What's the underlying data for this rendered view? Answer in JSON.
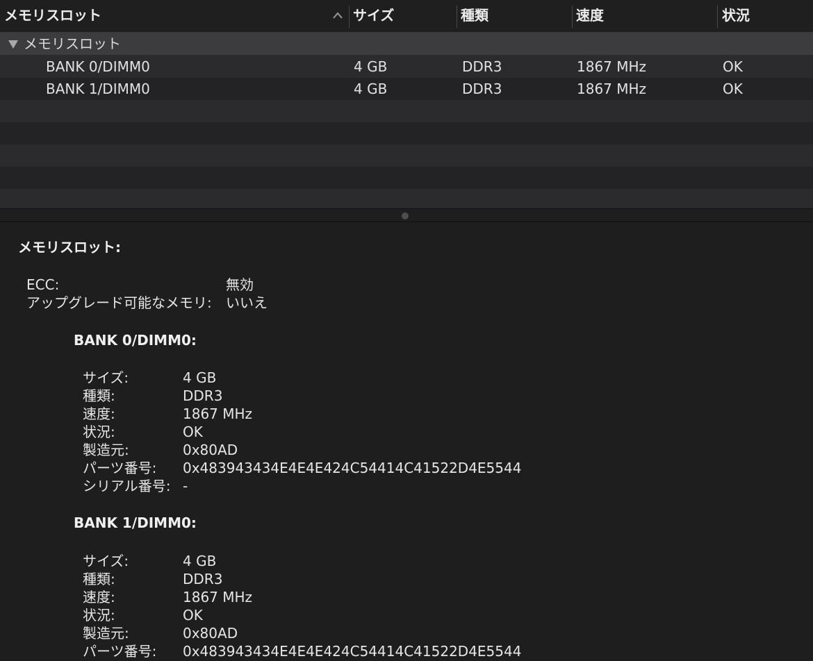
{
  "table": {
    "columns": {
      "name": "メモリスロット",
      "size": "サイズ",
      "type": "種類",
      "speed": "速度",
      "status": "状況"
    },
    "group_label": "メモリスロット",
    "rows": [
      {
        "name": "BANK 0/DIMM0",
        "size": "4 GB",
        "type": "DDR3",
        "speed": "1867 MHz",
        "status": "OK"
      },
      {
        "name": "BANK 1/DIMM0",
        "size": "4 GB",
        "type": "DDR3",
        "speed": "1867 MHz",
        "status": "OK"
      }
    ]
  },
  "detail": {
    "title": "メモリスロット:",
    "summary": [
      {
        "label": "ECC:",
        "value": "無効"
      },
      {
        "label": "アップグレード可能なメモリ:",
        "value": "いいえ"
      }
    ],
    "banks": [
      {
        "title": "BANK 0/DIMM0:",
        "fields": [
          {
            "label": "サイズ:",
            "value": "4 GB"
          },
          {
            "label": "種類:",
            "value": "DDR3"
          },
          {
            "label": "速度:",
            "value": "1867 MHz"
          },
          {
            "label": "状況:",
            "value": "OK"
          },
          {
            "label": "製造元:",
            "value": "0x80AD"
          },
          {
            "label": "パーツ番号:",
            "value": "0x483943434E4E4E424C54414C41522D4E5544"
          },
          {
            "label": "シリアル番号:",
            "value": "-"
          }
        ]
      },
      {
        "title": "BANK 1/DIMM0:",
        "fields": [
          {
            "label": "サイズ:",
            "value": "4 GB"
          },
          {
            "label": "種類:",
            "value": "DDR3"
          },
          {
            "label": "速度:",
            "value": "1867 MHz"
          },
          {
            "label": "状況:",
            "value": "OK"
          },
          {
            "label": "製造元:",
            "value": "0x80AD"
          },
          {
            "label": "パーツ番号:",
            "value": "0x483943434E4E4E424C54414C41522D4E5544"
          }
        ]
      }
    ]
  }
}
